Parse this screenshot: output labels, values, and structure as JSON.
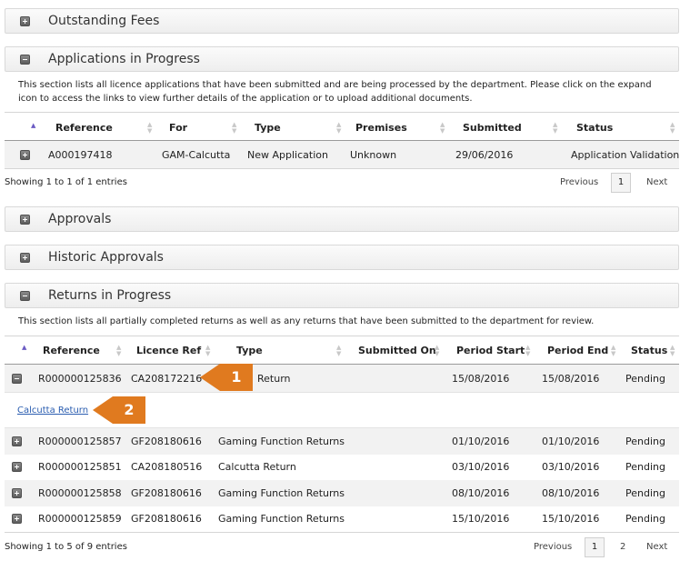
{
  "sections": {
    "outstanding_fees": "Outstanding Fees",
    "applications": "Applications in Progress",
    "approvals": "Approvals",
    "historic": "Historic Approvals",
    "returns": "Returns in Progress"
  },
  "applications": {
    "desc_line1": "This section lists all licence applications that have been submitted and are being processed by the department. Please click on the expand",
    "desc_line2": "icon to access the links to view further details of the application or to upload additional documents.",
    "columns": [
      "Reference",
      "For",
      "Type",
      "Premises",
      "Submitted",
      "Status"
    ],
    "rows": [
      {
        "reference": "A000197418",
        "for": "GAM-Calcutta",
        "type": "New Application",
        "premises": "Unknown",
        "submitted": "29/06/2016",
        "status": "Application Validation"
      }
    ],
    "info": "Showing 1 to 1 of 1 entries",
    "pager": {
      "previous": "Previous",
      "page1": "1",
      "next": "Next"
    }
  },
  "returns": {
    "desc": "This section lists all partially completed returns as well as any returns that have been submitted to the department for review.",
    "columns": [
      "Reference",
      "Licence Ref",
      "Type",
      "Submitted On",
      "Period Start",
      "Period End",
      "Status"
    ],
    "rows": [
      {
        "reference": "R000000125836",
        "licence": "CA208172216",
        "type": "Return",
        "submitted": "",
        "start": "15/08/2016",
        "end": "15/08/2016",
        "status": "Pending"
      },
      {
        "reference": "R000000125857",
        "licence": "GF208180616",
        "type": "Gaming Function Returns",
        "submitted": "",
        "start": "01/10/2016",
        "end": "01/10/2016",
        "status": "Pending"
      },
      {
        "reference": "R000000125851",
        "licence": "CA208180516",
        "type": "Calcutta Return",
        "submitted": "",
        "start": "03/10/2016",
        "end": "03/10/2016",
        "status": "Pending"
      },
      {
        "reference": "R000000125858",
        "licence": "GF208180616",
        "type": "Gaming Function Returns",
        "submitted": "",
        "start": "08/10/2016",
        "end": "08/10/2016",
        "status": "Pending"
      },
      {
        "reference": "R000000125859",
        "licence": "GF208180616",
        "type": "Gaming Function Returns",
        "submitted": "",
        "start": "15/10/2016",
        "end": "15/10/2016",
        "status": "Pending"
      }
    ],
    "expanded_link": "Calcutta Return",
    "info": "Showing 1 to 5 of 9 entries",
    "pager": {
      "previous": "Previous",
      "page1": "1",
      "page2": "2",
      "next": "Next"
    }
  },
  "callouts": {
    "one": "1",
    "two": "2"
  },
  "colors": {
    "accent": "#e07a1f",
    "link": "#2a5db0",
    "sort_active": "#6b5bc3"
  }
}
